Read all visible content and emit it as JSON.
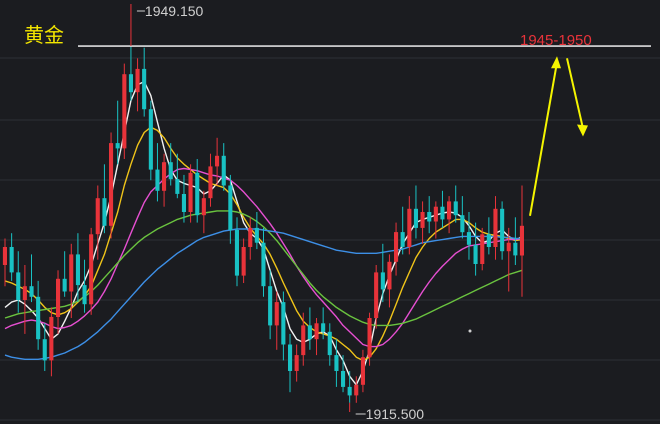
{
  "chart_data": {
    "type": "candlestick",
    "title": "黄金",
    "target_label": "1945-1950",
    "high_label": "1949.150",
    "low_label": "1915.500",
    "resistance_level": 1949.15,
    "ylim": [
      1913.5,
      1953.5
    ],
    "grid": true,
    "colors": {
      "background": "#1b1c20",
      "grid": "#2e3036",
      "up": "#e8333a",
      "down": "#19c2c4",
      "ma_white": "#f2f2f2",
      "ma_yellow": "#f0c419",
      "ma_pink": "#e64fd1",
      "ma_green": "#6ac33f",
      "ma_blue": "#3d8fe6",
      "arrow": "#f5f500",
      "title": "#f3e600",
      "target": "#e8333a",
      "level_line": "#ffffff"
    },
    "candles": [
      [
        1928.5,
        1931.0,
        1926.5,
        1930.2
      ],
      [
        1930.2,
        1931.5,
        1927.0,
        1927.8
      ],
      [
        1927.8,
        1929.8,
        1924.0,
        1925.2
      ],
      [
        1925.2,
        1928.5,
        1922.0,
        1926.5
      ],
      [
        1926.5,
        1929.5,
        1925.0,
        1925.5
      ],
      [
        1925.5,
        1927.0,
        1920.5,
        1921.5
      ],
      [
        1921.5,
        1923.0,
        1918.5,
        1919.5
      ],
      [
        1919.5,
        1924.5,
        1918.0,
        1923.6
      ],
      [
        1923.6,
        1928.0,
        1922.0,
        1927.2
      ],
      [
        1927.2,
        1929.8,
        1925.5,
        1926.0
      ],
      [
        1926.0,
        1930.5,
        1923.5,
        1929.5
      ],
      [
        1929.5,
        1931.5,
        1925.0,
        1926.6
      ],
      [
        1926.6,
        1929.0,
        1924.0,
        1924.8
      ],
      [
        1924.8,
        1932.0,
        1923.8,
        1931.4
      ],
      [
        1931.4,
        1936.0,
        1929.0,
        1934.8
      ],
      [
        1934.8,
        1938.0,
        1931.5,
        1932.2
      ],
      [
        1932.2,
        1941.0,
        1931.0,
        1940.0
      ],
      [
        1940.0,
        1944.0,
        1938.0,
        1939.5
      ],
      [
        1939.5,
        1947.5,
        1938.5,
        1946.5
      ],
      [
        1946.5,
        1949.15,
        1944.0,
        1944.8
      ],
      [
        1944.8,
        1948.0,
        1943.0,
        1947.0
      ],
      [
        1947.0,
        1949.0,
        1942.5,
        1943.2
      ],
      [
        1943.2,
        1944.0,
        1936.5,
        1937.5
      ],
      [
        1937.5,
        1940.0,
        1934.5,
        1935.5
      ],
      [
        1935.5,
        1939.0,
        1934.0,
        1938.2
      ],
      [
        1938.2,
        1940.0,
        1936.0,
        1936.6
      ],
      [
        1936.6,
        1939.0,
        1934.8,
        1935.2
      ],
      [
        1935.2,
        1937.0,
        1932.5,
        1933.5
      ],
      [
        1933.5,
        1938.0,
        1932.5,
        1937.2
      ],
      [
        1937.2,
        1938.5,
        1932.5,
        1933.2
      ],
      [
        1933.2,
        1935.5,
        1931.5,
        1934.8
      ],
      [
        1934.8,
        1939.0,
        1934.0,
        1937.8
      ],
      [
        1937.8,
        1940.5,
        1936.0,
        1938.8
      ],
      [
        1938.8,
        1940.0,
        1935.5,
        1936.0
      ],
      [
        1936.0,
        1937.0,
        1930.5,
        1931.8
      ],
      [
        1931.8,
        1933.0,
        1926.5,
        1927.5
      ],
      [
        1927.5,
        1931.0,
        1926.8,
        1930.2
      ],
      [
        1930.2,
        1933.0,
        1929.0,
        1932.0
      ],
      [
        1932.0,
        1933.5,
        1930.0,
        1930.6
      ],
      [
        1930.6,
        1932.0,
        1925.5,
        1926.5
      ],
      [
        1926.5,
        1928.0,
        1921.5,
        1922.8
      ],
      [
        1922.8,
        1926.0,
        1920.5,
        1925.0
      ],
      [
        1925.0,
        1926.0,
        1919.5,
        1921.0
      ],
      [
        1921.0,
        1922.0,
        1916.5,
        1918.5
      ],
      [
        1918.5,
        1921.0,
        1917.5,
        1920.0
      ],
      [
        1920.0,
        1924.0,
        1919.0,
        1922.8
      ],
      [
        1922.8,
        1924.5,
        1920.5,
        1921.5
      ],
      [
        1921.5,
        1923.5,
        1920.0,
        1923.0
      ],
      [
        1923.0,
        1924.5,
        1921.5,
        1922.2
      ],
      [
        1922.2,
        1923.0,
        1919.0,
        1920.0
      ],
      [
        1920.0,
        1921.5,
        1917.0,
        1918.5
      ],
      [
        1918.5,
        1920.0,
        1916.5,
        1917.0
      ],
      [
        1917.0,
        1918.5,
        1915.5,
        1916.2
      ],
      [
        1916.2,
        1918.0,
        1915.5,
        1917.2
      ],
      [
        1917.2,
        1920.5,
        1916.5,
        1919.8
      ],
      [
        1919.8,
        1924.0,
        1919.0,
        1923.5
      ],
      [
        1923.5,
        1928.5,
        1922.5,
        1927.8
      ],
      [
        1927.8,
        1930.5,
        1925.0,
        1926.2
      ],
      [
        1926.2,
        1929.5,
        1924.5,
        1928.8
      ],
      [
        1928.8,
        1932.5,
        1927.5,
        1931.6
      ],
      [
        1931.6,
        1934.0,
        1929.5,
        1930.2
      ],
      [
        1930.2,
        1935.0,
        1929.5,
        1933.8
      ],
      [
        1933.8,
        1936.0,
        1931.0,
        1932.0
      ],
      [
        1932.0,
        1934.5,
        1930.5,
        1933.5
      ],
      [
        1933.5,
        1935.0,
        1931.5,
        1932.6
      ],
      [
        1932.6,
        1934.5,
        1931.0,
        1934.0
      ],
      [
        1934.0,
        1935.5,
        1932.0,
        1932.8
      ],
      [
        1932.8,
        1935.0,
        1931.5,
        1934.5
      ],
      [
        1934.5,
        1936.0,
        1932.5,
        1933.2
      ],
      [
        1933.2,
        1935.0,
        1931.0,
        1931.6
      ],
      [
        1931.6,
        1933.5,
        1929.0,
        1930.4
      ],
      [
        1930.4,
        1932.5,
        1927.5,
        1928.6
      ],
      [
        1928.6,
        1932.0,
        1928.0,
        1931.4
      ],
      [
        1931.4,
        1933.0,
        1929.5,
        1930.2
      ],
      [
        1930.2,
        1935.0,
        1929.0,
        1933.8
      ],
      [
        1933.8,
        1934.5,
        1929.0,
        1929.8
      ],
      [
        1929.8,
        1932.0,
        1926.0,
        1930.6
      ],
      [
        1930.6,
        1933.0,
        1928.5,
        1929.4
      ],
      [
        1929.4,
        1936.0,
        1925.5,
        1932.2
      ]
    ],
    "moving_averages": [
      {
        "color": "ma_white",
        "values": [
          1924.5,
          1925,
          1925.2,
          1924.8,
          1924.2,
          1923.5,
          1922.5,
          1921.5,
          1922,
          1923.2,
          1924.5,
          1926,
          1927,
          1928.5,
          1930.5,
          1932.5,
          1935,
          1938,
          1941,
          1944,
          1945.5,
          1945.8,
          1944.5,
          1942,
          1939.5,
          1937.5,
          1936.5,
          1936.2,
          1936,
          1935.8,
          1935.2,
          1935.5,
          1936.2,
          1937,
          1936.5,
          1934.5,
          1932.5,
          1931.5,
          1931,
          1930,
          1928,
          1926,
          1924.5,
          1922.5,
          1921.5,
          1921.2,
          1921.5,
          1922,
          1922.2,
          1921.8,
          1920.5,
          1919.5,
          1918,
          1917.2,
          1918.5,
          1920.5,
          1923.5,
          1925.8,
          1927.5,
          1929,
          1930.5,
          1931.5,
          1932.5,
          1932.8,
          1933,
          1933.2,
          1933.4,
          1933.5,
          1933.4,
          1933,
          1932.2,
          1931.2,
          1930.6,
          1930.8,
          1931.5,
          1931.8,
          1931.2,
          1930.8,
          1931.2
        ]
      },
      {
        "color": "ma_yellow",
        "values": [
          1927,
          1926.8,
          1926.5,
          1926.2,
          1925.8,
          1925.2,
          1924.5,
          1924,
          1923.8,
          1924,
          1924.4,
          1925,
          1925.6,
          1926.5,
          1928,
          1929.5,
          1931.5,
          1933.5,
          1936,
          1938,
          1939.8,
          1941,
          1941.5,
          1941.2,
          1940.5,
          1939.5,
          1938.6,
          1938,
          1937.5,
          1937,
          1936.6,
          1936.2,
          1936,
          1935.8,
          1935.2,
          1934.2,
          1933,
          1932,
          1931.2,
          1930.5,
          1929.5,
          1928.2,
          1926.8,
          1925.5,
          1924.2,
          1923.2,
          1922.6,
          1922.2,
          1922,
          1921.8,
          1921.5,
          1921,
          1920.5,
          1919.8,
          1919.5,
          1919.8,
          1920.6,
          1921.8,
          1923.2,
          1924.8,
          1926.4,
          1927.8,
          1929.2,
          1930.2,
          1931,
          1931.6,
          1932,
          1932.4,
          1932.8,
          1932.8,
          1932.5,
          1932,
          1931.6,
          1931.4,
          1931.3,
          1931.2,
          1931,
          1930.8,
          1930.9
        ]
      },
      {
        "color": "ma_pink",
        "values": [
          1922.5,
          1922.8,
          1923,
          1923.2,
          1923.3,
          1923.2,
          1923,
          1922.7,
          1922.5,
          1922.6,
          1922.8,
          1923.2,
          1923.7,
          1924.3,
          1925,
          1926,
          1927.2,
          1928.6,
          1930,
          1931.5,
          1933,
          1934.4,
          1935.4,
          1936,
          1936.6,
          1937.1,
          1937.5,
          1937.6,
          1937.5,
          1937.4,
          1937.2,
          1937,
          1936.9,
          1936.7,
          1936.5,
          1936,
          1935.4,
          1934.7,
          1934,
          1933.2,
          1932.4,
          1931.5,
          1930.5,
          1929.5,
          1928.4,
          1927.4,
          1926.5,
          1925.7,
          1925,
          1924.3,
          1923.6,
          1922.8,
          1922.2,
          1921.6,
          1921,
          1920.8,
          1920.8,
          1921,
          1921.5,
          1922.2,
          1923,
          1924,
          1925,
          1926,
          1926.9,
          1927.7,
          1928.4,
          1929,
          1929.6,
          1930,
          1930.3,
          1930.4,
          1930.5,
          1930.6,
          1930.7,
          1930.8,
          1930.9,
          1930.9,
          1931
        ]
      },
      {
        "color": "ma_green",
        "values": [
          1923.5,
          1923.7,
          1923.9,
          1924,
          1924.1,
          1924.2,
          1924.3,
          1924.4,
          1924.5,
          1924.6,
          1924.8,
          1925.1,
          1925.5,
          1926,
          1926.6,
          1927.3,
          1928,
          1928.7,
          1929.4,
          1930,
          1930.6,
          1931.1,
          1931.5,
          1931.9,
          1932.2,
          1932.5,
          1932.8,
          1933,
          1933.2,
          1933.3,
          1933.4,
          1933.5,
          1933.6,
          1933.6,
          1933.6,
          1933.5,
          1933.3,
          1933,
          1932.6,
          1932.1,
          1931.5,
          1930.8,
          1930,
          1929.2,
          1928.4,
          1927.6,
          1926.8,
          1926.1,
          1925.5,
          1925,
          1924.5,
          1924.1,
          1923.7,
          1923.4,
          1923.1,
          1922.9,
          1922.8,
          1922.8,
          1922.8,
          1922.9,
          1923,
          1923.2,
          1923.4,
          1923.7,
          1924,
          1924.3,
          1924.6,
          1924.9,
          1925.2,
          1925.5,
          1925.8,
          1926.1,
          1926.4,
          1926.7,
          1927,
          1927.3,
          1927.6,
          1927.8,
          1928
        ]
      },
      {
        "color": "ma_blue",
        "values": [
          1920,
          1919.8,
          1919.7,
          1919.6,
          1919.6,
          1919.6,
          1919.7,
          1919.8,
          1920,
          1920.2,
          1920.5,
          1920.8,
          1921.2,
          1921.7,
          1922.2,
          1922.8,
          1923.4,
          1924.1,
          1924.8,
          1925.5,
          1926.2,
          1926.9,
          1927.5,
          1928.1,
          1928.6,
          1929.1,
          1929.6,
          1930,
          1930.4,
          1930.8,
          1931.1,
          1931.3,
          1931.5,
          1931.7,
          1931.8,
          1931.9,
          1931.9,
          1931.9,
          1931.9,
          1931.8,
          1931.7,
          1931.6,
          1931.5,
          1931.3,
          1931.1,
          1930.9,
          1930.7,
          1930.5,
          1930.3,
          1930.1,
          1929.9,
          1929.8,
          1929.7,
          1929.6,
          1929.6,
          1929.6,
          1929.6,
          1929.7,
          1929.8,
          1929.9,
          1930,
          1930.2,
          1930.4,
          1930.6,
          1930.7,
          1930.8,
          1930.9,
          1931,
          1931.1,
          1931.2,
          1931.2,
          1931.2,
          1931.2,
          1931.2,
          1931.2,
          1931.1,
          1931.1,
          1931,
          1931
        ]
      }
    ],
    "projection": {
      "peak": [
        1948.0
      ],
      "end": [
        1941.0
      ]
    }
  }
}
